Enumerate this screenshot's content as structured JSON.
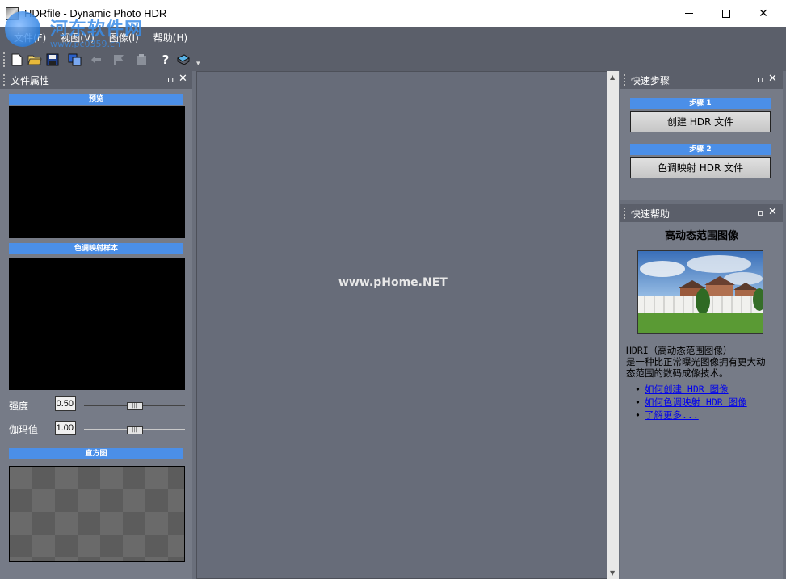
{
  "window": {
    "title": "HDRfile - Dynamic Photo HDR"
  },
  "watermark": {
    "text": "河东软件网",
    "url": "www.pc0359.cn",
    "center_text": "www.pHome.NET"
  },
  "menu": [
    "文件(F)",
    "视图(V)",
    "图像(I)",
    "帮助(H)"
  ],
  "toolbar": [
    "new-icon",
    "open-icon",
    "save-icon",
    "copy-icon",
    "back-icon",
    "flag-icon",
    "clipboard-icon",
    "help-icon",
    "info-icon"
  ],
  "left_panel": {
    "title": "文件属性",
    "pin": "ㅁ",
    "close": "✕",
    "preview_label": "预览",
    "tonemap_label": "色调映射样本",
    "strength_label": "强度",
    "strength_value": "0.50",
    "gamma_label": "伽玛值",
    "gamma_value": "1.00",
    "histogram_label": "直方图",
    "strength_fraction": 0.5,
    "gamma_fraction": 0.5
  },
  "steps_panel": {
    "title": "快速步骤",
    "step1_label": "步骤 1",
    "step1_button": "创建 HDR 文件",
    "step2_label": "步骤 2",
    "step2_button": "色调映射 HDR 文件"
  },
  "help_panel": {
    "title": "快速帮助",
    "heading": "高动态范围图像",
    "text_line1": "HDRI（高动态范围图像）",
    "text_line2": "是一种比正常曝光图像拥有更大动",
    "text_line3": "态范围的数码成像技术。",
    "links": [
      "如何创建 HDR 图像",
      "如何色调映射 HDR 图像",
      "了解更多..."
    ]
  },
  "colors": {
    "accent": "#4b8fe8",
    "panel_bg": "#767b87",
    "workspace": "#676c79",
    "bar": "#5b5f6a"
  }
}
